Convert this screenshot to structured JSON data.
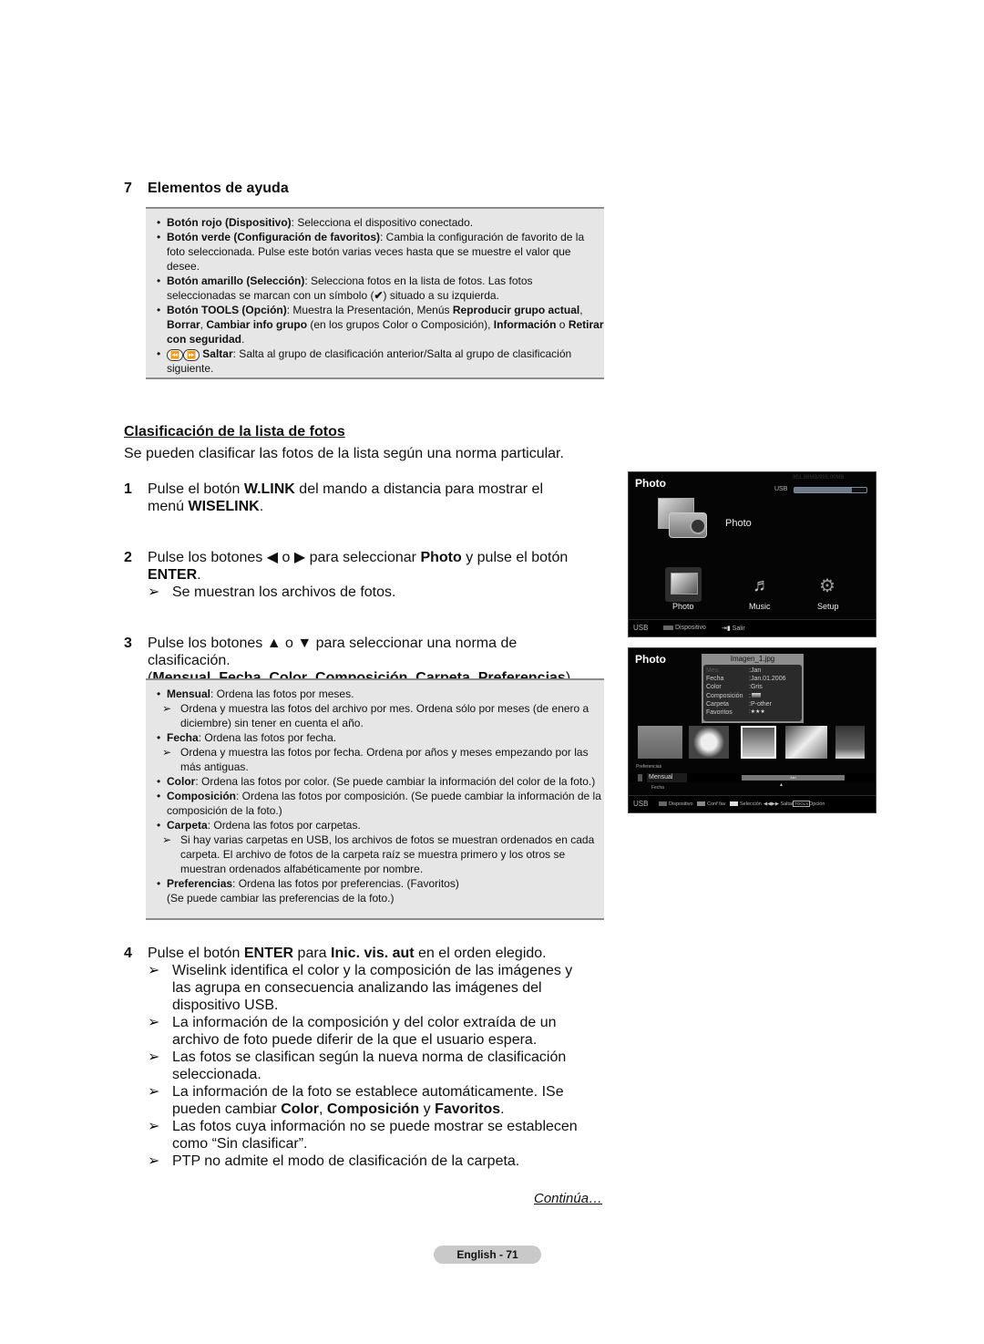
{
  "section7": {
    "number": "7",
    "title": "Elementos de ayuda",
    "items": [
      {
        "bold": "Botón rojo (Dispositivo)",
        "text": ": Selecciona el dispositivo conectado."
      },
      {
        "bold": "Botón verde (Configuración de favoritos)",
        "text": ": Cambia la configuración de favorito de la foto seleccionada. Pulse este botón varias veces hasta que se muestre el valor que desee."
      },
      {
        "bold": "Botón amarillo (Selección)",
        "text": ": Selecciona fotos en la lista de fotos. Las fotos seleccionadas se marcan con un símbolo (",
        "symbol": "✔",
        "text2": ") situado a su izquierda."
      },
      {
        "bold": "Botón TOOLS (Opción)",
        "text": ": Muestra la Presentación, Menús ",
        "b2": "Reproducir grupo actual",
        "t2": ", ",
        "b3": "Borrar",
        "t3": ", ",
        "b4": "Cambiar info grupo",
        "t4": " (en los grupos Color o Composición), ",
        "b5": "Información",
        "t5": " o ",
        "b6": "Retirar con seguridad",
        "t6": "."
      },
      {
        "icon_left": "⏪",
        "icon_right": "⏩",
        "bold": "Saltar",
        "text": ": Salta al grupo de clasificación anterior/Salta al grupo de clasificación siguiente."
      }
    ]
  },
  "sort_section": {
    "title": "Clasificación de la lista de fotos",
    "intro": "Se pueden clasificar las fotos de la lista según una norma particular.",
    "step1": {
      "n": "1",
      "a": "Pulse el botón ",
      "b": "W.LINK",
      "c": " del mando a distancia para mostrar el menú ",
      "d": "WISELINK",
      "e": "."
    },
    "step2": {
      "n": "2",
      "a": "Pulse los botones ◀ o ▶ para seleccionar ",
      "b": "Photo",
      "c": " y pulse el botón ",
      "d": "ENTER",
      "e": ".",
      "note": "Se muestran los archivos de fotos."
    },
    "step3": {
      "n": "3",
      "a": "Pulse los botones ▲ o ▼ para seleccionar una norma de clasificación.",
      "opts": [
        "Mensual",
        "Fecha",
        "Color",
        "Composición",
        "Carpeta",
        "Preferencias"
      ]
    },
    "criteria": [
      {
        "bold": "Mensual",
        "text": ": Ordena las fotos por meses.",
        "note": "Ordena y muestra las fotos del archivo por mes. Ordena sólo por meses (de enero a diciembre) sin tener en cuenta el año."
      },
      {
        "bold": "Fecha",
        "text": ": Ordena las fotos por fecha.",
        "note": "Ordena y muestra las fotos por fecha. Ordena por años y meses empezando por las más antiguas."
      },
      {
        "bold": "Color",
        "text": ": Ordena las fotos por color. (Se puede cambiar la información del color de la foto.)"
      },
      {
        "bold": "Composición",
        "text": ": Ordena las fotos por composición. (Se puede cambiar la información de la composición de la foto.)"
      },
      {
        "bold": "Carpeta",
        "text": ": Ordena las fotos por carpetas.",
        "note": "Si hay varias carpetas en USB, los archivos de fotos se muestran ordenados en cada carpeta. El archivo de fotos de la carpeta raíz se muestra primero y los otros se muestran ordenados alfabéticamente por nombre."
      },
      {
        "bold": "Preferencias",
        "text": ": Ordena las fotos por preferencias. (Favoritos)",
        "extra": "(Se puede cambiar las preferencias de la foto.)"
      }
    ],
    "step4": {
      "n": "4",
      "a": "Pulse el botón ",
      "b": "ENTER",
      "c": " para ",
      "d": "Inic. vis. aut",
      "e": " en el orden elegido.",
      "notes": [
        "Wiselink identifica el color y la composición de las imágenes y las agrupa en consecuencia analizando las imágenes del dispositivo USB.",
        "La información de la composición y del color extraída de un archivo de foto puede diferir de la que el usuario espera.",
        "Las fotos se clasifican según la nueva norma de clasificación seleccionada."
      ],
      "note4": {
        "a": "La información de la foto se establece automáticamente. ISe pueden cambiar ",
        "b": "Color",
        "c": ", ",
        "d": "Composición",
        "e": " y ",
        "f": "Favoritos",
        "g": "."
      },
      "notes_after": [
        "Las fotos cuya información no se puede mostrar se establecen como “Sin clasificar”.",
        "PTP no admite el modo de clasificación de la carpeta."
      ]
    },
    "arrow_glyph": "➢",
    "bullet_glyph": "•",
    "continues": "Continúa…"
  },
  "tv1": {
    "title": "Photo",
    "usb_label": "USB",
    "capacity": "851.98MB/995.00MB",
    "usage_fraction": 0.8,
    "hero_label": "Photo",
    "menu": [
      {
        "label": "Photo",
        "icon": "photo-icon",
        "selected": true
      },
      {
        "label": "Music",
        "icon": "music-icon",
        "selected": false
      },
      {
        "label": "Setup",
        "icon": "gear-icon",
        "selected": false
      }
    ],
    "footer": {
      "device": "USB",
      "dispositivo": "Dispositivo",
      "salir": "Salir"
    }
  },
  "tv2": {
    "title": "Photo",
    "filename": "Imagen_1.jpg",
    "info": [
      {
        "k": "Mes",
        "v": "Jan"
      },
      {
        "k": "Fecha",
        "v": "Jan.01.2006"
      },
      {
        "k": "Color",
        "v": "Gris"
      },
      {
        "k": "Composición",
        "v": ""
      },
      {
        "k": "Carpeta",
        "v": "P-other"
      },
      {
        "k": "Favoritos",
        "v": "★★★"
      }
    ],
    "sort_prev": "Preferencias",
    "sort_current": "Mensual",
    "sort_next": "Fecha",
    "group_label": "Jan",
    "footer": {
      "device": "USB",
      "dispositivo": "Dispositivo",
      "conf": "Conf fav",
      "sel": "Selección",
      "saltar": "Saltar",
      "tools": "TOOLS",
      "opcion": "Opción"
    }
  },
  "page_footer": "English - 71"
}
